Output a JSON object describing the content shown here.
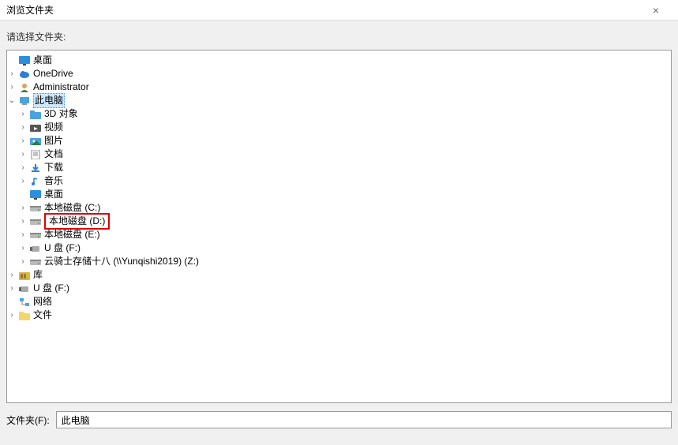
{
  "window": {
    "title": "浏览文件夹"
  },
  "prompt": "请选择文件夹:",
  "footer": {
    "label": "文件夹(F):",
    "value": "此电脑"
  },
  "tree": [
    {
      "id": "desktop",
      "indent": 1,
      "expander": "none",
      "icon": "desktop",
      "label": "桌面",
      "selected": false
    },
    {
      "id": "onedrive",
      "indent": 1,
      "expander": "closed",
      "icon": "cloud",
      "label": "OneDrive",
      "selected": false
    },
    {
      "id": "admin",
      "indent": 1,
      "expander": "closed",
      "icon": "user",
      "label": "Administrator",
      "selected": false
    },
    {
      "id": "thispc",
      "indent": 1,
      "expander": "open",
      "icon": "pc",
      "label": "此电脑",
      "selected": true
    },
    {
      "id": "3dobj",
      "indent": 2,
      "expander": "closed",
      "icon": "folder3d",
      "label": "3D 对象",
      "selected": false
    },
    {
      "id": "videos",
      "indent": 2,
      "expander": "closed",
      "icon": "video",
      "label": "视频",
      "selected": false
    },
    {
      "id": "pictures",
      "indent": 2,
      "expander": "closed",
      "icon": "pictures",
      "label": "图片",
      "selected": false
    },
    {
      "id": "documents",
      "indent": 2,
      "expander": "closed",
      "icon": "docs",
      "label": "文档",
      "selected": false
    },
    {
      "id": "downloads",
      "indent": 2,
      "expander": "closed",
      "icon": "download",
      "label": "下载",
      "selected": false
    },
    {
      "id": "music",
      "indent": 2,
      "expander": "closed",
      "icon": "music",
      "label": "音乐",
      "selected": false
    },
    {
      "id": "desk2",
      "indent": 2,
      "expander": "none",
      "icon": "desktop",
      "label": "桌面",
      "selected": false
    },
    {
      "id": "drivec",
      "indent": 2,
      "expander": "closed",
      "icon": "drive",
      "label": "本地磁盘 (C:)",
      "selected": false
    },
    {
      "id": "drived",
      "indent": 2,
      "expander": "closed",
      "icon": "drive",
      "label": "本地磁盘 (D:)",
      "selected": false,
      "highlight": true
    },
    {
      "id": "drivee",
      "indent": 2,
      "expander": "closed",
      "icon": "drive",
      "label": "本地磁盘 (E:)",
      "selected": false
    },
    {
      "id": "usbf",
      "indent": 2,
      "expander": "closed",
      "icon": "usb",
      "label": "U 盘 (F:)",
      "selected": false
    },
    {
      "id": "netz",
      "indent": 2,
      "expander": "closed",
      "icon": "drive",
      "label": "云骑士存储十八 (\\\\Yunqishi2019) (Z:)",
      "selected": false
    },
    {
      "id": "libs",
      "indent": 1,
      "expander": "closed",
      "icon": "libs",
      "label": "库",
      "selected": false
    },
    {
      "id": "usbf2",
      "indent": 1,
      "expander": "closed",
      "icon": "usb",
      "label": "U 盘 (F:)",
      "selected": false
    },
    {
      "id": "network",
      "indent": 1,
      "expander": "none",
      "icon": "network",
      "label": "网络",
      "selected": false
    },
    {
      "id": "files",
      "indent": 1,
      "expander": "closed",
      "icon": "folder",
      "label": "文件",
      "selected": false
    }
  ]
}
